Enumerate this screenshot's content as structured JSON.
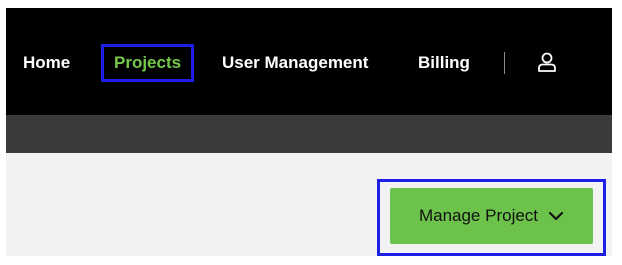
{
  "nav": {
    "items": [
      {
        "label": "Home",
        "active": false
      },
      {
        "label": "Projects",
        "active": true
      },
      {
        "label": "User Management",
        "active": false
      },
      {
        "label": "Billing",
        "active": false
      }
    ],
    "user_icon": "user-icon"
  },
  "actions": {
    "manage_project_label": "Manage Project",
    "manage_project_icon": "chevron-down-icon"
  },
  "colors": {
    "topbar": "#000000",
    "subbar": "#3b3b3b",
    "active_nav": "#74c94a",
    "button": "#6cc24a",
    "highlight": "#1d1ee6"
  }
}
